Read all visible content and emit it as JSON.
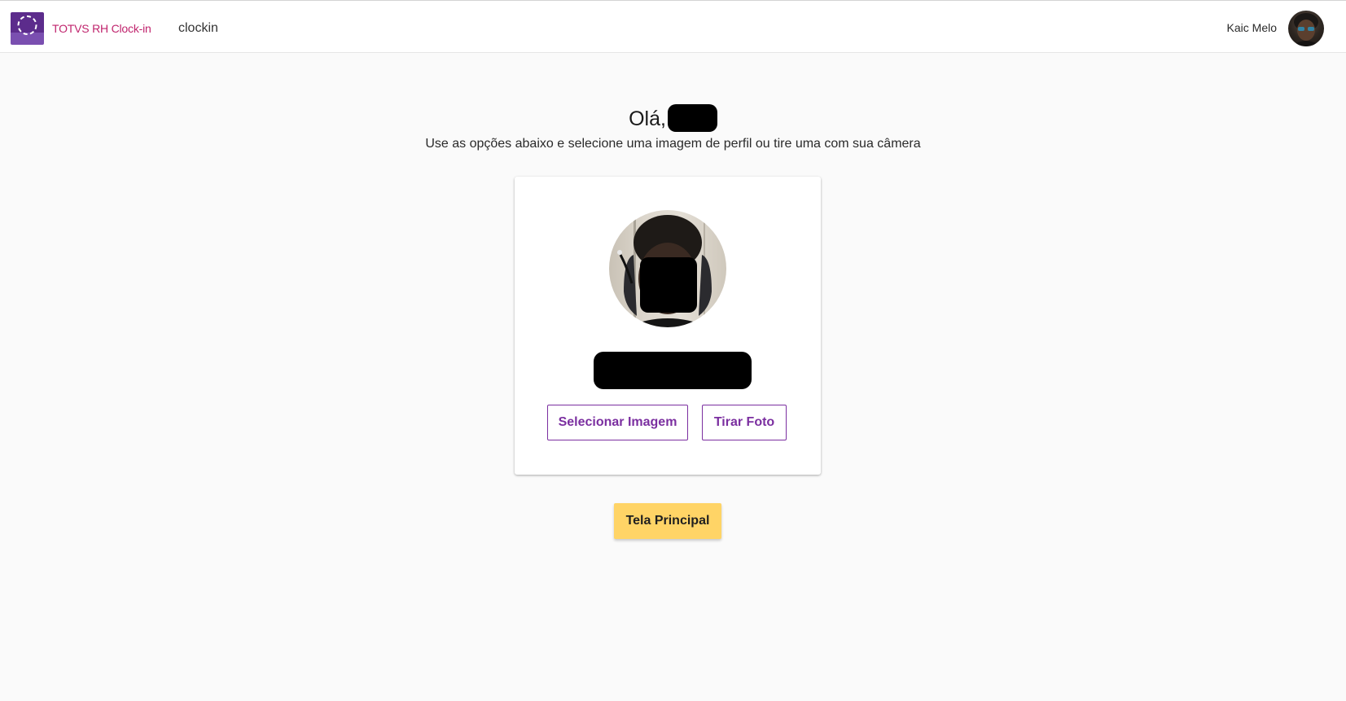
{
  "header": {
    "app_name": "TOTVS RH Clock-in",
    "route_label": "clockin",
    "user_name": "Kaic Melo",
    "logo_icon": "dashed-circle-icon",
    "brand_color": "#5c2c8c",
    "app_name_color": "#c0246d"
  },
  "main": {
    "greeting": "Olá,",
    "subtitle": "Use as opções abaixo e selecione uma imagem de perfil ou tire uma com sua câmera"
  },
  "card": {
    "select_image_label": "Selecionar Imagem",
    "take_photo_label": "Tirar Foto",
    "button_color": "#7b2fa0"
  },
  "footer": {
    "main_screen_label": "Tela Principal",
    "button_color": "#ffd466"
  }
}
